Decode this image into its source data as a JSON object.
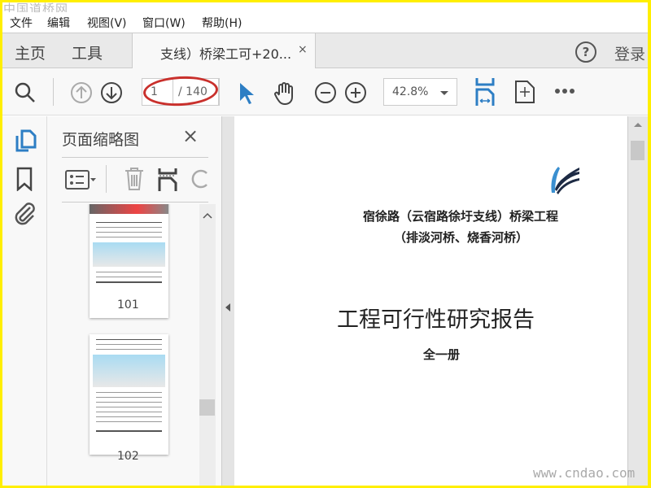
{
  "watermarks": {
    "top": "中国道桥网",
    "bottom": "www.cndao.com"
  },
  "menu": [
    "文件",
    "编辑",
    "视图(V)",
    "窗口(W)",
    "帮助(H)"
  ],
  "tabs": {
    "home": "主页",
    "tools": "工具",
    "document": "支线）桥梁工可+20...",
    "close": "×",
    "help": "?",
    "login": "登录"
  },
  "toolbar": {
    "current_page": "1",
    "total_pages": "/ 140",
    "zoom": "42.8%"
  },
  "panel": {
    "title": "页面缩略图",
    "close": "×",
    "thumbnails": [
      {
        "label": "101"
      },
      {
        "label": "102"
      }
    ]
  },
  "document": {
    "line1": "宿徐路（云宿路徐圩支线）桥梁工程",
    "line2": "（排淡河桥、烧香河桥）",
    "title": "工程可行性研究报告",
    "volume": "全一册"
  },
  "colors": {
    "accent": "#2d7ec4",
    "highlight": "#c9302c",
    "frame": "#ffef00"
  }
}
